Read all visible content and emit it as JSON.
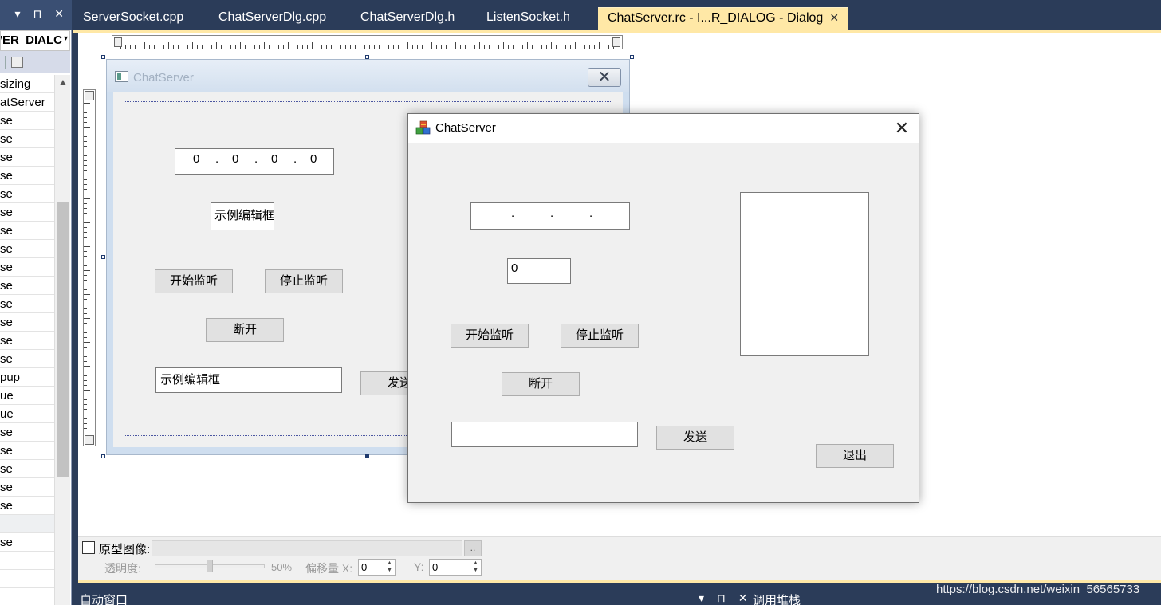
{
  "left_panel": {
    "header_icons": "▾ ⊓ ✕",
    "combo_value": "VER_DIALC",
    "properties": [
      "sizing",
      "atServer",
      "se",
      "se",
      "se",
      "se",
      "se",
      "se",
      "se",
      "se",
      "se",
      "se",
      "se",
      "se",
      "se",
      "se",
      "pup",
      "ue",
      "ue",
      "se",
      "se",
      "se",
      "se",
      "se",
      "",
      "se",
      "",
      ""
    ]
  },
  "tabs": [
    {
      "label": "ServerSocket.cpp"
    },
    {
      "label": "ChatServerDlg.cpp"
    },
    {
      "label": "ChatServerDlg.h"
    },
    {
      "label": "ListenSocket.h"
    },
    {
      "label": "ChatServer.rc - I...R_DIALOG - Dialog",
      "close": "✕"
    }
  ],
  "design_dialog": {
    "title": "ChatServer",
    "close_symbol": "✕",
    "ip": [
      "0",
      ".",
      "0",
      ".",
      "0",
      ".",
      "0"
    ],
    "port_edit": "示例编辑框",
    "start_button": "开始监听",
    "stop_button": "停止监听",
    "disconnect_button": "断开",
    "message_edit": "示例编辑框",
    "send_button": "发送"
  },
  "run_dialog": {
    "title": "ChatServer",
    "close_symbol": "✕",
    "ip_dots": [
      ".",
      ".",
      "."
    ],
    "port_value": "0",
    "start_button": "开始监听",
    "stop_button": "停止监听",
    "disconnect_button": "断开",
    "message_value": "",
    "send_button": "发送",
    "exit_button": "退出"
  },
  "prototype_bar": {
    "checkbox_label": "原型图像:",
    "browse": "..",
    "opacity_label": "透明度:",
    "opacity_value": "50%",
    "opacity_fraction": 0.5,
    "offset_label": "偏移量 X:",
    "offset_x": "0",
    "y_label": "Y:",
    "offset_y": "0"
  },
  "bottom": {
    "auto_window": "自动窗口",
    "auto_window_icons": "▾ ⊓ ✕",
    "call_stack": "调用堆栈",
    "watermark": "https://blog.csdn.net/weixin_56565733"
  },
  "colors": {
    "ide_dark": "#2b3c59",
    "tab_active": "#ffe8a6",
    "dialog_bg": "#f0f0f0"
  }
}
